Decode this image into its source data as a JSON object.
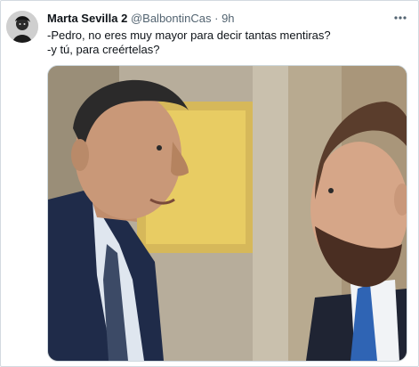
{
  "tweet": {
    "author_name": "Marta Sevilla 2",
    "author_handle": "@BalbontinCas",
    "separator": "·",
    "time": "9h",
    "lines": [
      "-Pedro, no eres muy mayor para decir tantas mentiras?",
      "-y tú, para creértelas?"
    ]
  },
  "icons": {
    "avatar": "avatar-image",
    "more": "more-options-icon"
  },
  "photo": {
    "description_icon": "photo-two-men-facing"
  },
  "colors": {
    "text_primary": "#0f1419",
    "text_secondary": "#536471",
    "border": "#cfd9de"
  }
}
